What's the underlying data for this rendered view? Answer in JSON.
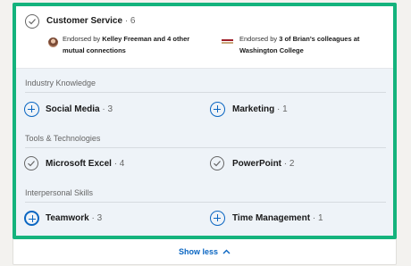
{
  "top_skill": {
    "name": "Customer Service",
    "count": "· 6",
    "endorsement_left": {
      "prefix": "Endorsed by ",
      "name": "Kelley Freeman and 4 other",
      "line2": "mutual connections"
    },
    "endorsement_right": {
      "prefix": "Endorsed by ",
      "name": "3 of Brian’s colleagues at",
      "line2": "Washington College"
    }
  },
  "categories": [
    {
      "title": "Industry Knowledge",
      "skills": [
        {
          "name": "Social Media",
          "count": "· 3",
          "state": "plus"
        },
        {
          "name": "Marketing",
          "count": "· 1",
          "state": "plus"
        }
      ]
    },
    {
      "title": "Tools & Technologies",
      "skills": [
        {
          "name": "Microsoft Excel",
          "count": "· 4",
          "state": "check"
        },
        {
          "name": "PowerPoint",
          "count": "· 2",
          "state": "check"
        }
      ]
    },
    {
      "title": "Interpersonal Skills",
      "skills": [
        {
          "name": "Teamwork",
          "count": "· 3",
          "state": "plus"
        },
        {
          "name": "Time Management",
          "count": "· 1",
          "state": "plus"
        }
      ]
    }
  ],
  "footer": {
    "show_less_label": "Show less",
    "chevron": "chevron-up-icon"
  },
  "colors": {
    "highlight": "#14b37d",
    "link": "#0a66c2",
    "section_bg": "#eef3f8"
  }
}
